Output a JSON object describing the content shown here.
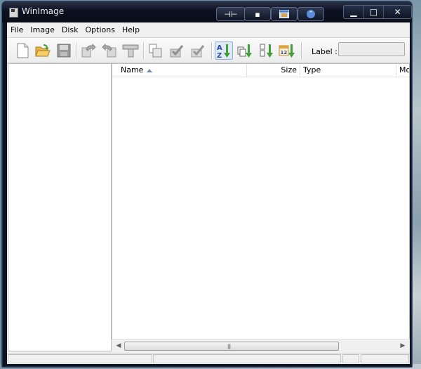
{
  "window": {
    "title": "WinImage",
    "caption_min": "▁",
    "caption_max": "□",
    "caption_close": "✕",
    "extra_pin": "⊣⊢",
    "extra_min": "▪",
    "extra_roll": "⌃"
  },
  "menu": {
    "items": [
      {
        "label": "File"
      },
      {
        "label": "Image"
      },
      {
        "label": "Disk"
      },
      {
        "label": "Options"
      },
      {
        "label": "Help"
      }
    ]
  },
  "toolbar": {
    "label_text": "Label :",
    "label_value": "",
    "buttons": [
      "new-icon",
      "open-icon",
      "save-icon",
      "extract-icon",
      "inject-icon",
      "format-icon",
      "delete-icon",
      "check-icon",
      "check-disabled-icon",
      "sort-name-icon",
      "sort-size-icon",
      "sort-type-icon",
      "sort-date-icon"
    ],
    "sort_name_glyph": "AZ",
    "sort_date_glyph": "12"
  },
  "list": {
    "columns": [
      {
        "label": "Name"
      },
      {
        "label": "Size"
      },
      {
        "label": "Type"
      },
      {
        "label": "Mo"
      }
    ],
    "sort_column": "Name",
    "sort_direction": "ascending"
  },
  "colors": {
    "accent_green": "#3fa03a",
    "frame": "#0d1320",
    "panel": "#f0f0f0"
  }
}
